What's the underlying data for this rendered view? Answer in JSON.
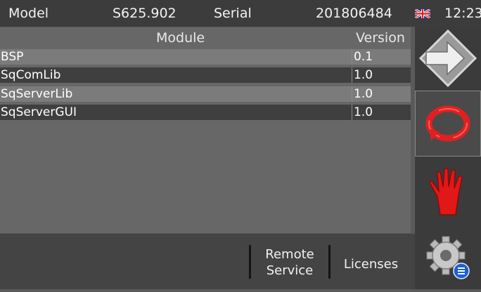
{
  "header": {
    "model_label": "Model",
    "model_value": "S625.902",
    "serial_label": "Serial",
    "serial_value": "201806484",
    "time": "12:23",
    "language_icon": "uk-flag-icon"
  },
  "table": {
    "columns": [
      "Module",
      "Version"
    ],
    "rows": [
      {
        "module": "BSP",
        "version": "0.1"
      },
      {
        "module": "SqComLib",
        "version": "1.0"
      },
      {
        "module": "SqServerLib",
        "version": "1.0"
      },
      {
        "module": "SqServerGUI",
        "version": "1.0"
      }
    ]
  },
  "bottom_bar": {
    "remote_service_line1": "Remote",
    "remote_service_line2": "Service",
    "licenses_label": "Licenses"
  },
  "sidebar": {
    "items": [
      {
        "name": "forward-arrow-icon"
      },
      {
        "name": "refresh-ring-icon"
      },
      {
        "name": "red-glove-icon"
      },
      {
        "name": "settings-gear-icon"
      }
    ]
  }
}
